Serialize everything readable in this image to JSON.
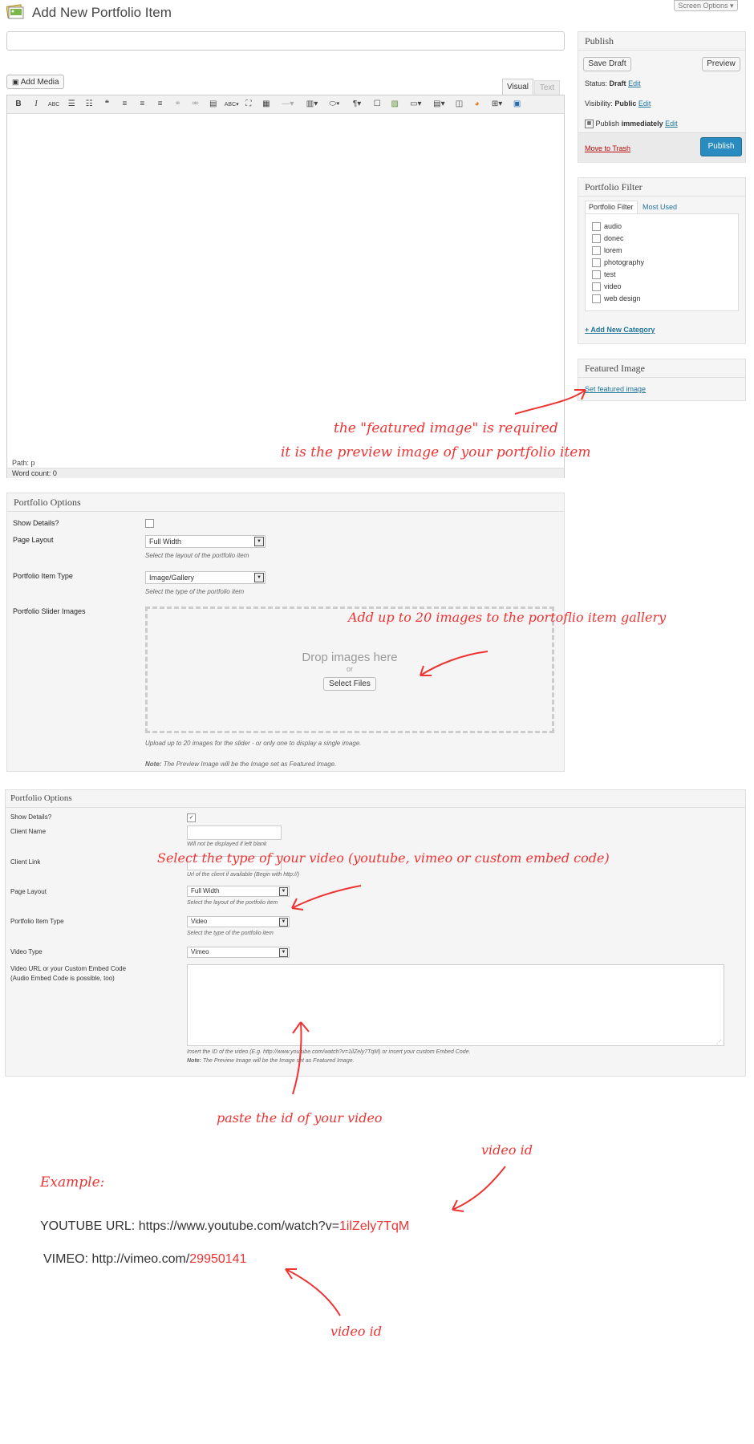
{
  "header": {
    "title": "Add New Portfolio Item",
    "screen_options": "Screen Options ▾"
  },
  "editor": {
    "add_media": "Add Media",
    "tab_visual": "Visual",
    "tab_text": "Text",
    "path": "Path: p",
    "word_count": "Word count: 0"
  },
  "publish": {
    "title": "Publish",
    "save_draft": "Save Draft",
    "preview": "Preview",
    "status_label": "Status:",
    "status_value": "Draft",
    "visibility_label": "Visibility:",
    "visibility_value": "Public",
    "publish_label": "Publish",
    "publish_value": "immediately",
    "edit": "Edit",
    "move_to_trash": "Move to Trash",
    "publish_button": "Publish"
  },
  "portfolio_filter": {
    "title": "Portfolio Filter",
    "tab_all": "Portfolio Filter",
    "tab_most_used": "Most Used",
    "categories": [
      "audio",
      "donec",
      "lorem",
      "photography",
      "test",
      "video",
      "web design"
    ],
    "add_new": "+ Add New Category"
  },
  "featured_image": {
    "title": "Featured Image",
    "link": "Set featured image"
  },
  "options1": {
    "title": "Portfolio Options",
    "show_details": "Show Details?",
    "page_layout": "Page Layout",
    "page_layout_value": "Full Width",
    "page_layout_help": "Select the layout of the portfolio item",
    "item_type": "Portfolio Item Type",
    "item_type_value": "Image/Gallery",
    "item_type_help": "Select the type of the portfolio item",
    "slider_images": "Portfolio Slider Images",
    "drop_text": "Drop images here",
    "or": "or",
    "select_files": "Select Files",
    "upload_help": "Upload up to 20 images for the slider - or only one to display a single image.",
    "note_label": "Note:",
    "note_text": "The Preview Image will be the Image set as Featured Image."
  },
  "options2": {
    "title": "Portfolio Options",
    "show_details": "Show Details?",
    "client_name": "Client Name",
    "client_name_help": "Will not be displayed if left blank",
    "client_link": "Client Link",
    "client_link_help": "Url of the client if available (Begin with http://)",
    "page_layout": "Page Layout",
    "page_layout_value": "Full Width",
    "page_layout_help": "Select the layout of the portfolio item",
    "item_type": "Portfolio Item Type",
    "item_type_value": "Video",
    "item_type_help": "Select the type of the portfolio item",
    "video_type": "Video Type",
    "video_type_value": "Vimeo",
    "video_url_label1": "Video URL or your Custom Embed Code",
    "video_url_label2": "(Audio Embed Code is possible, too)",
    "video_help": "Insert the ID of the video (E.g. http://www.youtube.com/watch?v=1ilZely7TqM) or insert your custom Embed Code.",
    "note_label": "Note:",
    "note_text": "The Preview Image will be the Image set as Featured Image."
  },
  "annotations": {
    "featured_1": "the \"featured image\" is required",
    "featured_2": "it is the preview image of your portfolio item",
    "add_images": "Add up to 20 images to the portoflio item gallery",
    "select_type": "Select the type of your video (youtube, vimeo or custom embed code)",
    "paste_id": "paste the id of your video",
    "video_id_1": "video id",
    "video_id_2": "video id",
    "example": "Example:",
    "youtube_prefix": "YOUTUBE URL: https://www.youtube.com/watch?v=",
    "youtube_id": "1ilZely7TqM",
    "vimeo_prefix": "VIMEO: http://vimeo.com/",
    "vimeo_id": "29950141"
  },
  "colors": {
    "accent_red": "#e33333",
    "link_blue": "#21759b",
    "publish_blue": "#2a8bc0"
  }
}
